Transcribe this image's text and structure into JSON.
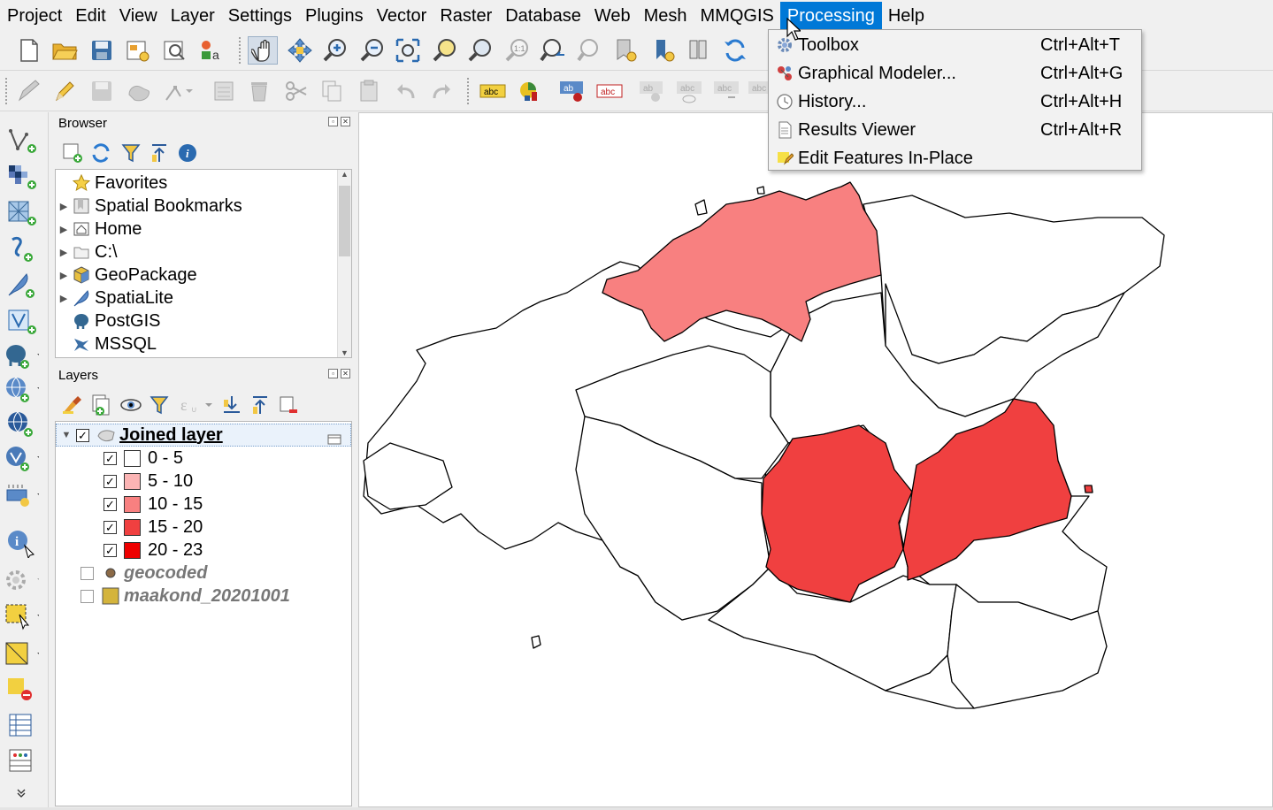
{
  "menubar": {
    "items": [
      "Project",
      "Edit",
      "View",
      "Layer",
      "Settings",
      "Plugins",
      "Vector",
      "Raster",
      "Database",
      "Web",
      "Mesh",
      "MMQGIS",
      "Processing",
      "Help"
    ],
    "active": "Processing"
  },
  "processing_menu": {
    "items": [
      {
        "label": "Toolbox",
        "shortcut": "Ctrl+Alt+T",
        "icon": "gear-icon"
      },
      {
        "label": "Graphical Modeler...",
        "shortcut": "Ctrl+Alt+G",
        "icon": "model-icon"
      },
      {
        "label": "History...",
        "shortcut": "Ctrl+Alt+H",
        "icon": "clock-icon"
      },
      {
        "label": "Results Viewer",
        "shortcut": "Ctrl+Alt+R",
        "icon": "document-icon"
      },
      {
        "label": "Edit Features In-Place",
        "shortcut": "",
        "icon": "pencil-icon"
      }
    ]
  },
  "browser": {
    "title": "Browser",
    "items": [
      {
        "label": "Favorites",
        "icon": "star-icon",
        "expandable": false
      },
      {
        "label": "Spatial Bookmarks",
        "icon": "bookmark-icon",
        "expandable": true
      },
      {
        "label": "Home",
        "icon": "home-icon",
        "expandable": true
      },
      {
        "label": "C:\\",
        "icon": "folder-icon",
        "expandable": true
      },
      {
        "label": "GeoPackage",
        "icon": "geopackage-icon",
        "expandable": true
      },
      {
        "label": "SpatiaLite",
        "icon": "feather-icon",
        "expandable": true
      },
      {
        "label": "PostGIS",
        "icon": "elephant-icon",
        "expandable": false
      },
      {
        "label": "MSSQL",
        "icon": "mssql-icon",
        "expandable": false
      }
    ]
  },
  "layers": {
    "title": "Layers",
    "joined_layer": {
      "label": "Joined layer",
      "checked": true
    },
    "classes": [
      {
        "label": "0 - 5",
        "color": "#ffffff",
        "checked": true
      },
      {
        "label": "5 - 10",
        "color": "#fbb4b4",
        "checked": true
      },
      {
        "label": "10 - 15",
        "color": "#f88080",
        "checked": true
      },
      {
        "label": "15 - 20",
        "color": "#f04040",
        "checked": true
      },
      {
        "label": "20 - 23",
        "color": "#ee0000",
        "checked": true
      }
    ],
    "other_layers": [
      {
        "label": "geocoded",
        "checked": false,
        "symbol_color": "#8b6a47"
      },
      {
        "label": "maakond_20201001",
        "checked": false,
        "symbol_color": "#d4b43c"
      }
    ]
  },
  "colors": {
    "accent": "#0078d7",
    "region_medium": "#f88080",
    "region_high": "#f04040"
  }
}
